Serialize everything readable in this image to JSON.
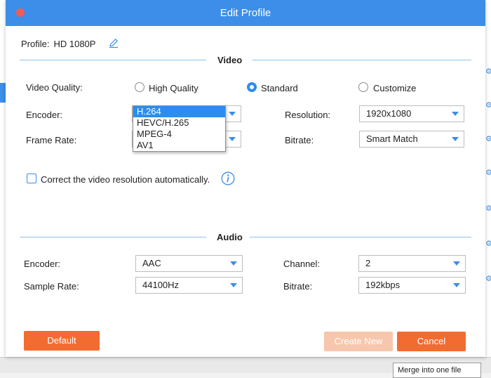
{
  "dialog": {
    "title": "Edit Profile",
    "profile_label": "Profile:",
    "profile_value": "HD 1080P"
  },
  "video": {
    "section_title": "Video",
    "quality_label": "Video Quality:",
    "quality_options": [
      "High Quality",
      "Standard",
      "Customize"
    ],
    "quality_selected": "Standard",
    "encoder_label": "Encoder:",
    "encoder_options": [
      "H.264",
      "HEVC/H.265",
      "MPEG-4",
      "AV1"
    ],
    "encoder_selected": "H.264",
    "frame_rate_label": "Frame Rate:",
    "resolution_label": "Resolution:",
    "resolution_value": "1920x1080",
    "bitrate_label": "Bitrate:",
    "bitrate_value": "Smart Match",
    "auto_resolution_label": "Correct the video resolution automatically."
  },
  "audio": {
    "section_title": "Audio",
    "encoder_label": "Encoder:",
    "encoder_value": "AAC",
    "sample_rate_label": "Sample Rate:",
    "sample_rate_value": "44100Hz",
    "channel_label": "Channel:",
    "channel_value": "2",
    "bitrate_label": "Bitrate:",
    "bitrate_value": "192kbps"
  },
  "buttons": {
    "default": "Default",
    "create_new": "Create New",
    "cancel": "Cancel"
  },
  "background": {
    "merge_label": "Merge into one file"
  },
  "colors": {
    "accent": "#3c8ee8",
    "primary_button": "#f26c32",
    "disabled_button": "#f6c7ad",
    "close_button": "#f25b55"
  }
}
